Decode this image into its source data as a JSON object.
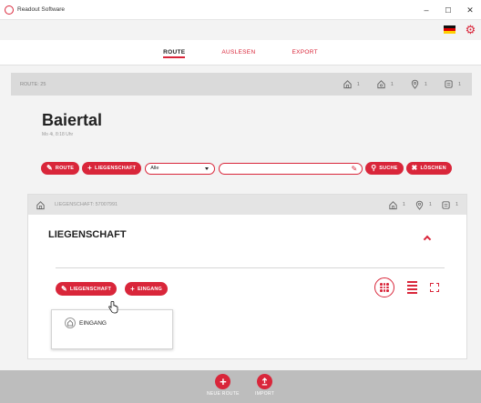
{
  "window": {
    "title": "Readout Software",
    "controls": {
      "minimize": "–",
      "maximize": "☐",
      "close": "✕"
    }
  },
  "topbar": {
    "language_flag": "german-flag",
    "settings_icon": "gear-icon"
  },
  "nav": {
    "tabs": [
      {
        "label": "ROUTE",
        "active": true
      },
      {
        "label": "AUSLESEN",
        "active": false
      },
      {
        "label": "EXPORT",
        "active": false
      }
    ]
  },
  "route": {
    "label": "ROUTE: 25",
    "stats": [
      {
        "icon": "house-icon",
        "value": "1"
      },
      {
        "icon": "house-outline-icon",
        "value": "1"
      },
      {
        "icon": "location-pin-icon",
        "value": "1"
      },
      {
        "icon": "meter-icon",
        "value": "1"
      }
    ],
    "city": "Baiertal",
    "datetime": "Mo 4i, 8:18 Uhr"
  },
  "actions": {
    "route_button": "ROUTE",
    "property_button": "LIEGENSCHAFT",
    "filter_value": "Alle",
    "search_value": "",
    "search_button": "SUCHE",
    "delete_button": "LÖSCHEN"
  },
  "property": {
    "header_id": "LIEGENSCHAFT: 57007991",
    "stats": [
      {
        "icon": "house-icon",
        "value": "1"
      },
      {
        "icon": "location-pin-icon",
        "value": "1"
      },
      {
        "icon": "meter-icon",
        "value": "1"
      }
    ],
    "title": "LIEGENSCHAFT",
    "edit_button": "LIEGENSCHAFT",
    "add_entrance_button": "EINGANG",
    "entrance": {
      "label": "EINGANG"
    }
  },
  "bottom": {
    "new_route": "NEUE ROUTE",
    "import": "IMPORT"
  },
  "colors": {
    "accent": "#d9263a",
    "bottom_bar": "#bdbdbd"
  }
}
